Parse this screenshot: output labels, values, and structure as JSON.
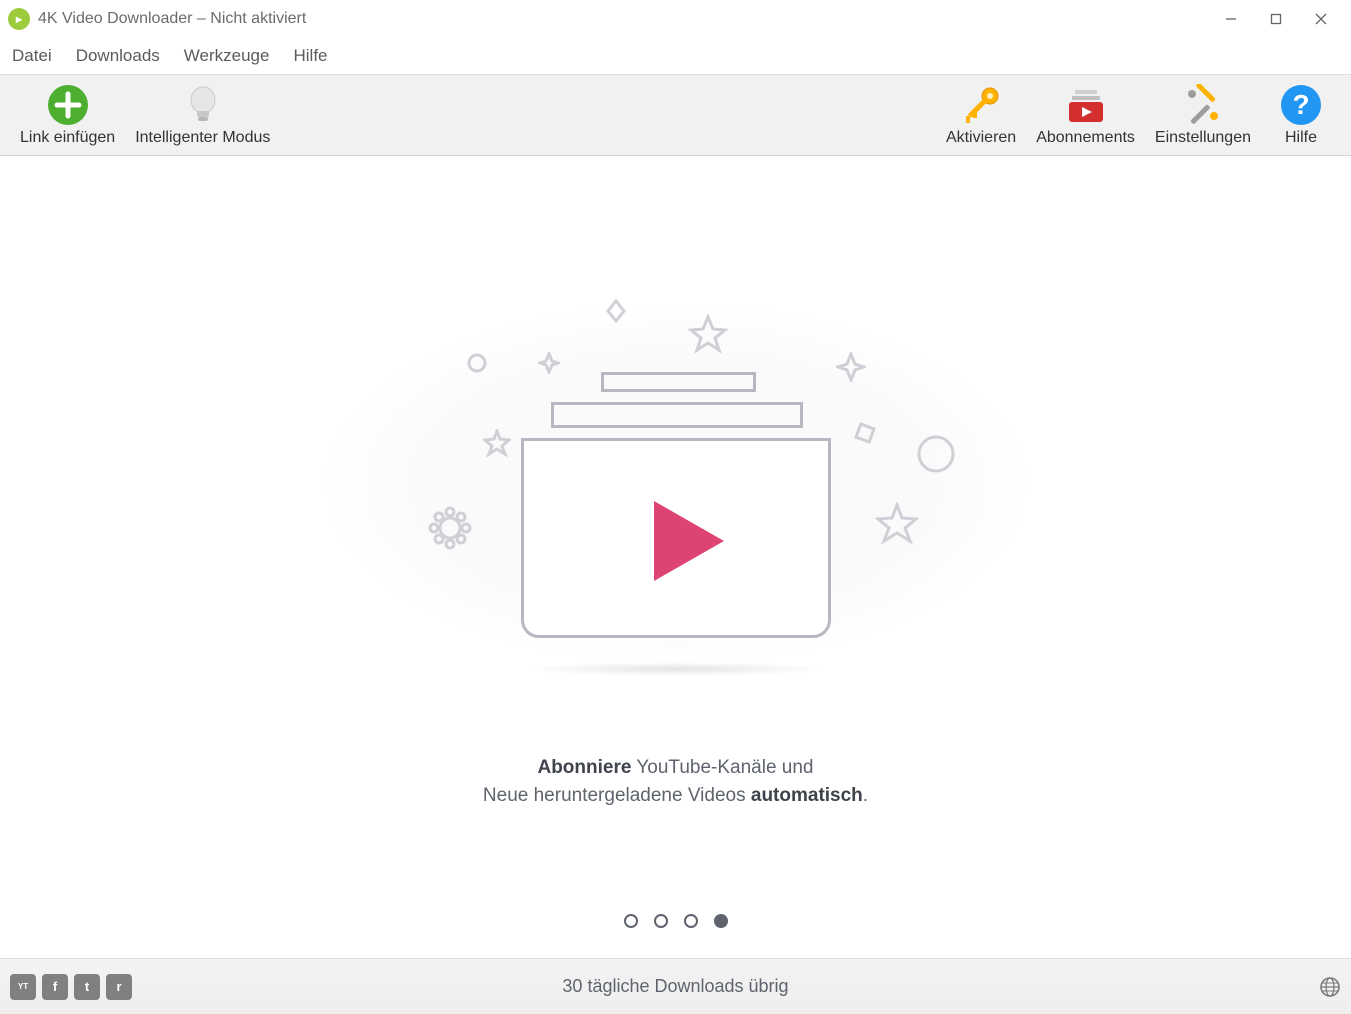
{
  "titlebar": {
    "title": "4K Video Downloader – Nicht aktiviert"
  },
  "menubar": {
    "items": [
      "Datei",
      "Downloads",
      "Werkzeuge",
      "Hilfe"
    ]
  },
  "toolbar": {
    "paste_link": "Link einfügen",
    "smart_mode": "Intelligenter Modus",
    "activate": "Aktivieren",
    "subscriptions": "Abonnements",
    "settings": "Einstellungen",
    "help": "Hilfe"
  },
  "content": {
    "caption_bold_1": "Abonniere",
    "caption_text_1": " YouTube-Kanäle und",
    "caption_text_2": "Neue heruntergeladene Videos ",
    "caption_bold_2": "automatisch",
    "caption_text_3": "."
  },
  "pager": {
    "count": 4,
    "active_index": 3
  },
  "statusbar": {
    "downloads_remaining": "30 tägliche Downloads übrig",
    "social": {
      "youtube": "YT",
      "facebook": "f",
      "twitter": "t",
      "reddit": "r"
    }
  }
}
